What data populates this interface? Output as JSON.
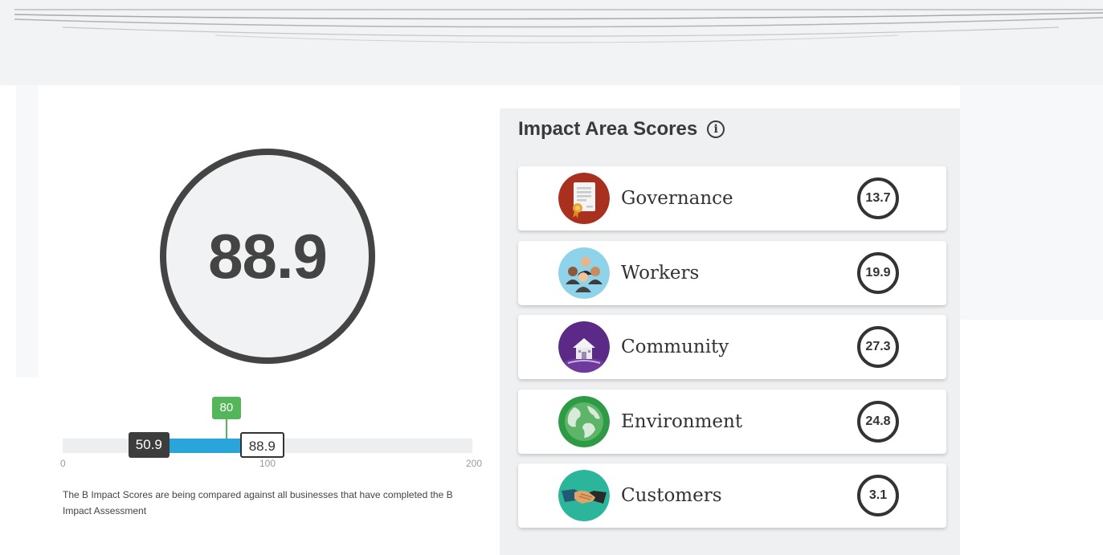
{
  "overall": {
    "score": "88.9"
  },
  "comparison": {
    "median_label": "50.9",
    "company_label": "88.9",
    "qualify_label": "80",
    "median_value": 50.9,
    "company_value": 88.9,
    "qualify_value": 80,
    "axis_min": 0,
    "axis_max": 200,
    "tick_min": "0",
    "tick_mid": "100",
    "tick_max": "200",
    "colors": {
      "fill": "#2aa5dc",
      "median": "#3d3d3d",
      "qualify": "#55b55a"
    },
    "note": "The B Impact Scores are being compared against all businesses that have completed the B Impact Assessment"
  },
  "impact_panel": {
    "title": "Impact Area Scores",
    "info_icon": "info-icon",
    "areas": [
      {
        "name": "Governance",
        "score": "13.7",
        "icon": "document-certificate-icon",
        "color": "#a9301f"
      },
      {
        "name": "Workers",
        "score": "19.9",
        "icon": "people-group-icon",
        "color": "#8fd3ea"
      },
      {
        "name": "Community",
        "score": "27.3",
        "icon": "house-icon",
        "color": "#5b2a86"
      },
      {
        "name": "Environment",
        "score": "24.8",
        "icon": "globe-icon",
        "color": "#2f9a45"
      },
      {
        "name": "Customers",
        "score": "3.1",
        "icon": "handshake-icon",
        "color": "#2bb59b"
      }
    ]
  }
}
